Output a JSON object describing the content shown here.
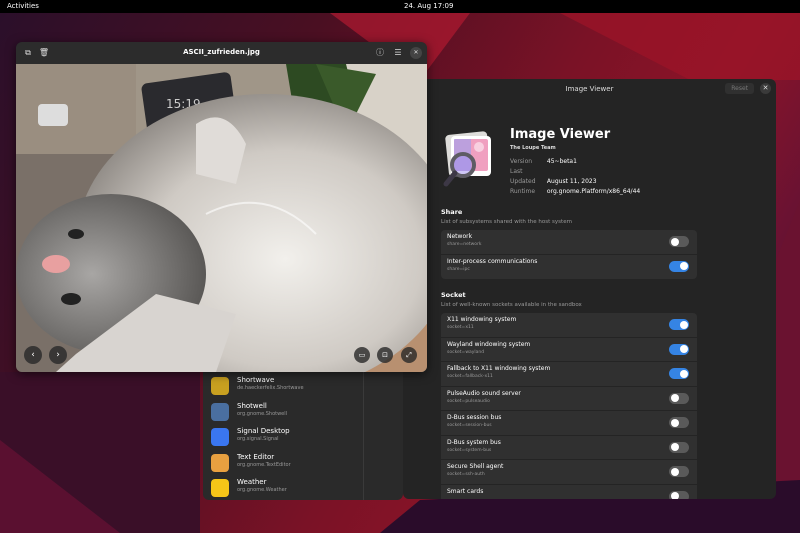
{
  "topbar": {
    "activities": "Activities",
    "clock": "24. Aug  17:09"
  },
  "viewer": {
    "title": "ASCII_zufrieden.jpg",
    "photo_clock": "15:19"
  },
  "flatseal": {
    "header_title": "Image Viewer",
    "reset_label": "Reset",
    "app_name": "Image Viewer",
    "team": "The Loupe Team",
    "meta": [
      {
        "key": "Version",
        "value": "45~beta1"
      },
      {
        "key": "Last Updated",
        "value": "August 11, 2023"
      },
      {
        "key": "Runtime",
        "value": "org.gnome.Platform/x86_64/44"
      }
    ],
    "share": {
      "title": "Share",
      "subtitle": "List of subsystems shared with the host system",
      "rows": [
        {
          "title": "Network",
          "sub": "share=network",
          "on": false
        },
        {
          "title": "Inter-process communications",
          "sub": "share=ipc",
          "on": true
        }
      ]
    },
    "socket": {
      "title": "Socket",
      "subtitle": "List of well-known sockets available in the sandbox",
      "rows": [
        {
          "title": "X11 windowing system",
          "sub": "socket=x11",
          "on": true
        },
        {
          "title": "Wayland windowing system",
          "sub": "socket=wayland",
          "on": true
        },
        {
          "title": "Fallback to X11 windowing system",
          "sub": "socket=fallback-x11",
          "on": true
        },
        {
          "title": "PulseAudio sound server",
          "sub": "socket=pulseaudio",
          "on": false
        },
        {
          "title": "D-Bus session bus",
          "sub": "socket=session-bus",
          "on": false
        },
        {
          "title": "D-Bus system bus",
          "sub": "socket=system-bus",
          "on": false
        },
        {
          "title": "Secure Shell agent",
          "sub": "socket=ssh-auth",
          "on": false
        },
        {
          "title": "Smart cards",
          "sub": "",
          "on": false
        }
      ]
    }
  },
  "apps": [
    {
      "name": "Shortwave",
      "id": "de.haeckerfelix.Shortwave",
      "color": "#c8a020"
    },
    {
      "name": "Shotwell",
      "id": "org.gnome.Shotwell",
      "color": "#4a6fa0"
    },
    {
      "name": "Signal Desktop",
      "id": "org.signal.Signal",
      "color": "#3a76f0"
    },
    {
      "name": "Text Editor",
      "id": "org.gnome.TextEditor",
      "color": "#e8a040"
    },
    {
      "name": "Weather",
      "id": "org.gnome.Weather",
      "color": "#f5c518"
    }
  ],
  "colors": {
    "accent": "#3584e4"
  }
}
